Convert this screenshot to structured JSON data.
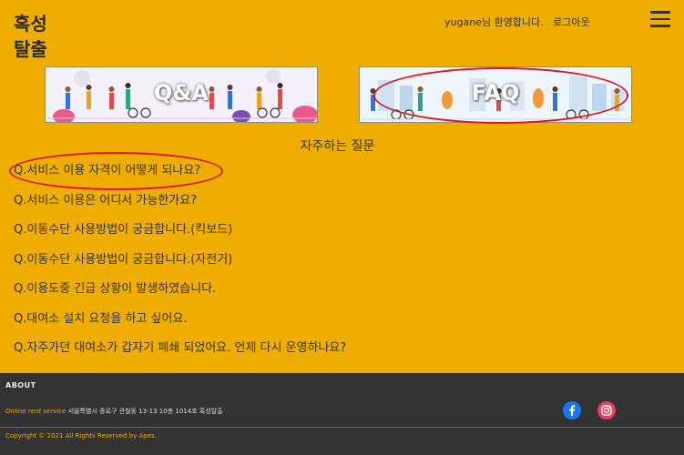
{
  "header": {
    "logo_line1": "혹성",
    "logo_line2": "탈출",
    "welcome": "yugane님 환영합니다.",
    "logout": "로그아웃",
    "menu_icon": "hamburger-menu-icon"
  },
  "banners": [
    {
      "label": "Q&A"
    },
    {
      "label": "FAQ"
    }
  ],
  "faq": {
    "title": "자주하는 질문",
    "questions": [
      "Q.서비스 이용 자격이 어떻게 되나요?",
      "Q.서비스 이용은 어디서 가능한가요?",
      "Q.이동수단 사용방법이 궁금합니다.(킥보드)",
      "Q.이동수단 사용방법이 궁금합니다.(자전거)",
      "Q.이용도중 긴급 상황이 발생하였습니다.",
      "Q.대여소 설치 요청을 하고 싶어요.",
      "Q.자주가던 대여소가 갑자기 폐쇄 되었어요. 언제 다시 운영하나요?"
    ]
  },
  "footer": {
    "about": "ABOUT",
    "brand": "Online rent service",
    "address": " 서울특별시 종로구 관철동 13-13 10층 1014호 혹성탈출",
    "copyright": "Copyright © 2021 All Rights Reserved by Apes.",
    "social": [
      "facebook-icon",
      "instagram-icon"
    ]
  },
  "colors": {
    "background": "#efad00",
    "footer": "#333333",
    "annotation_red": "#d8161b"
  }
}
